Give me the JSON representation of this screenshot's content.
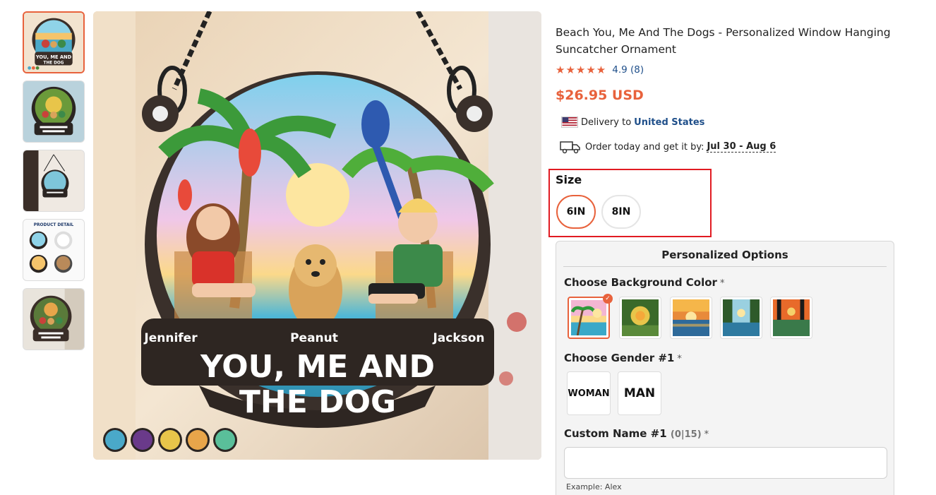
{
  "product": {
    "title": "Beach You, Me And The Dogs - Personalized Window Hanging Suncatcher Ornament",
    "stars": "★★★★★",
    "rating_text": "4.9 (8)",
    "price": "$26.95 USD"
  },
  "delivery": {
    "prefix": "Delivery to",
    "country": "United States",
    "order_prefix": "Order today and get it by:",
    "dates": "Jul 30 - Aug 6"
  },
  "size": {
    "label": "Size",
    "options": [
      "6IN",
      "8IN"
    ],
    "selected": "6IN"
  },
  "image": {
    "names": [
      "Jennifer",
      "Peanut",
      "Jackson"
    ],
    "headline_1": "YOU, ME AND",
    "headline_2": "THE DOG"
  },
  "thumbnails": {
    "tiny_caption_1": "YOU, ME AND",
    "tiny_caption_2": "THE DOG",
    "detail_title": "PRODUCT DETAIL"
  },
  "personalized": {
    "title": "Personalized Options",
    "bg_label": "Choose Background Color",
    "required_mark": "*",
    "gender_label": "Choose Gender #1",
    "gender_options": [
      "WOMAN",
      "MAN"
    ],
    "name_label": "Custom Name #1",
    "name_count": "(0|15)",
    "name_value": "",
    "example": "Example: Alex",
    "check_mark": "✓"
  },
  "colors": {
    "accent": "#e8623c",
    "link": "#1f4f8a",
    "highlight_box": "#e11b22"
  }
}
